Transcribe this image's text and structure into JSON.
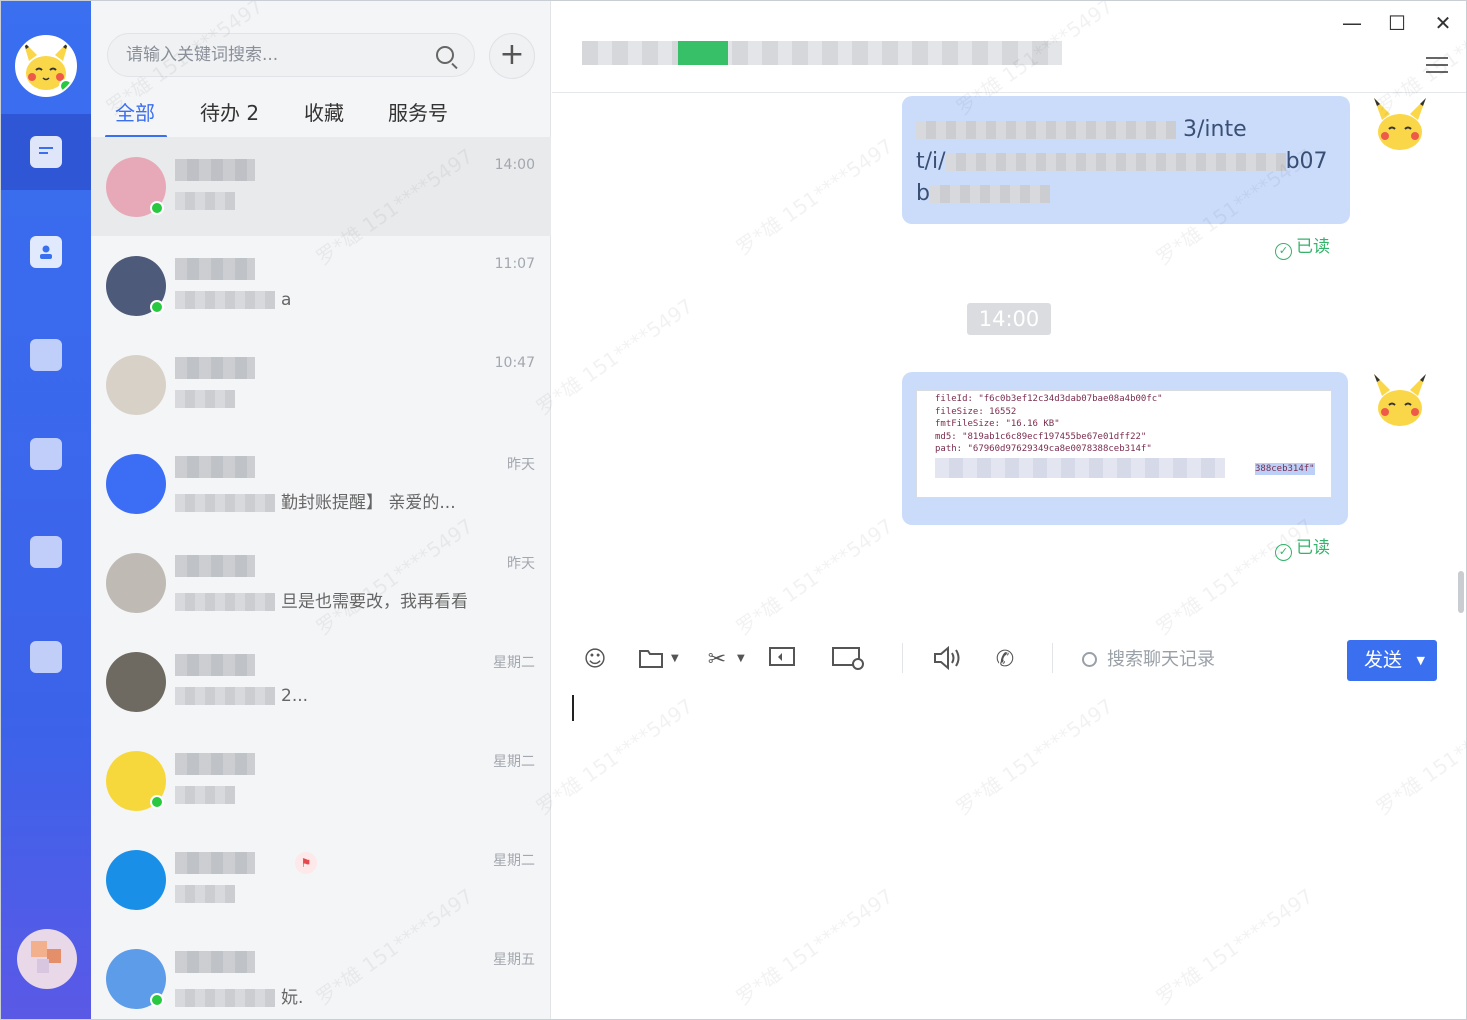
{
  "search": {
    "placeholder": "请输入关键词搜索..."
  },
  "add_label": "+",
  "tabs": [
    {
      "label": "全部",
      "active": true
    },
    {
      "label": "待办 2",
      "active": false
    },
    {
      "label": "收藏",
      "active": false
    },
    {
      "label": "服务号",
      "active": false
    }
  ],
  "conversations": [
    {
      "time": "14:00",
      "preview": "",
      "online": true,
      "avatar_color": "#e7a9b7"
    },
    {
      "time": "11:07",
      "preview": "a",
      "online": true,
      "avatar_color": "#4d5a7a"
    },
    {
      "time": "10:47",
      "preview": "",
      "online": false,
      "avatar_color": "#d8d1c8"
    },
    {
      "time": "昨天",
      "preview": "勤封账提醒】 亲爱的...",
      "online": false,
      "avatar_color": "#3b6ef5"
    },
    {
      "time": "昨天",
      "preview": "旦是也需要改，我再看看",
      "online": false,
      "avatar_color": "#bfbab4"
    },
    {
      "time": "星期二",
      "preview": "2...",
      "online": false,
      "avatar_color": "#6f6a61"
    },
    {
      "time": "星期二",
      "preview": "",
      "online": true,
      "avatar_color": "#f7d83c"
    },
    {
      "time": "星期二",
      "preview": "",
      "online": false,
      "avatar_color": "#1a8fe8",
      "flagged": true
    },
    {
      "time": "星期五",
      "preview": "妧.",
      "online": true,
      "avatar_color": "#5d9ce8"
    }
  ],
  "chat": {
    "window_controls": {
      "minimize": "—",
      "maximize": "☐",
      "close": "✕"
    },
    "messages": [
      {
        "lines": [
          "3/inte",
          "t/i/",
          "b07",
          "b"
        ],
        "status": "已读"
      },
      {
        "status": "已读"
      }
    ],
    "timestamp": "14:00",
    "code_lines": [
      "fileId: \"f6c0b3ef12c34d3dab07bae08a4b00fc\"",
      "fileSize: 16552",
      "fmtFileSize: \"16.16 KB\"",
      "md5: \"819ab1c6c89ecf197455be67e01dff22\"",
      "path: \"67960d97629349ca8e0078388ceb314f\""
    ],
    "code_tail": "388ceb314f\""
  },
  "toolbar": {
    "search_history": "搜索聊天记录",
    "send_label": "发送",
    "dropdown_caret": "▼"
  },
  "watermark": "罗*雄 151****5497"
}
